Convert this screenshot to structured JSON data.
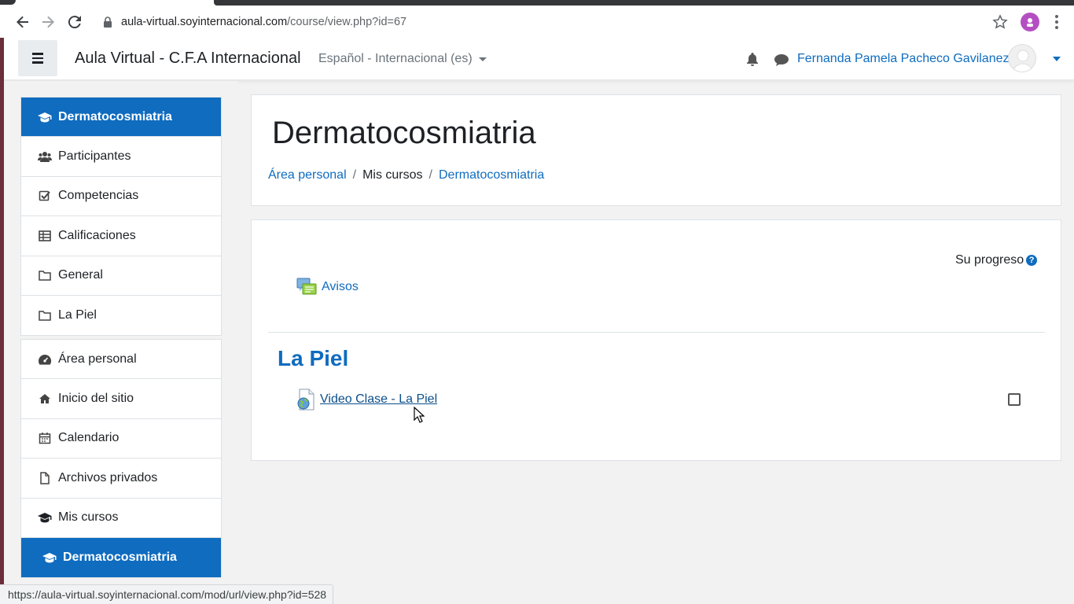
{
  "browser": {
    "url_host": "aula-virtual.soyinternacional.com",
    "url_path": "/course/view.php?id=67",
    "status_url": "https://aula-virtual.soyinternacional.com/mod/url/view.php?id=528"
  },
  "navbar": {
    "brand": "Aula Virtual - C.F.A Internacional",
    "language": "Español - Internacional (es)",
    "username": "Fernanda Pamela Pacheco Gavilanez"
  },
  "drawer": {
    "course_items": [
      {
        "label": "Dermatocosmiatria"
      },
      {
        "label": "Participantes"
      },
      {
        "label": "Competencias"
      },
      {
        "label": "Calificaciones"
      },
      {
        "label": "General"
      },
      {
        "label": "La Piel"
      }
    ],
    "site_items": [
      {
        "label": "Área personal"
      },
      {
        "label": "Inicio del sitio"
      },
      {
        "label": "Calendario"
      },
      {
        "label": "Archivos privados"
      },
      {
        "label": "Mis cursos"
      },
      {
        "label": "Dermatocosmiatria"
      }
    ]
  },
  "header": {
    "title": "Dermatocosmiatria",
    "breadcrumb": {
      "home": "Área personal",
      "sep": "/",
      "mid": "Mis cursos",
      "current": "Dermatocosmiatria"
    }
  },
  "content": {
    "progress_label": "Su progreso",
    "progress_help": "?",
    "announcements": "Avisos",
    "section_title": "La Piel",
    "activity_link": "Video Clase - La Piel"
  },
  "colors": {
    "accent": "#0f6cbf",
    "active_bg": "#0f6cbf"
  }
}
